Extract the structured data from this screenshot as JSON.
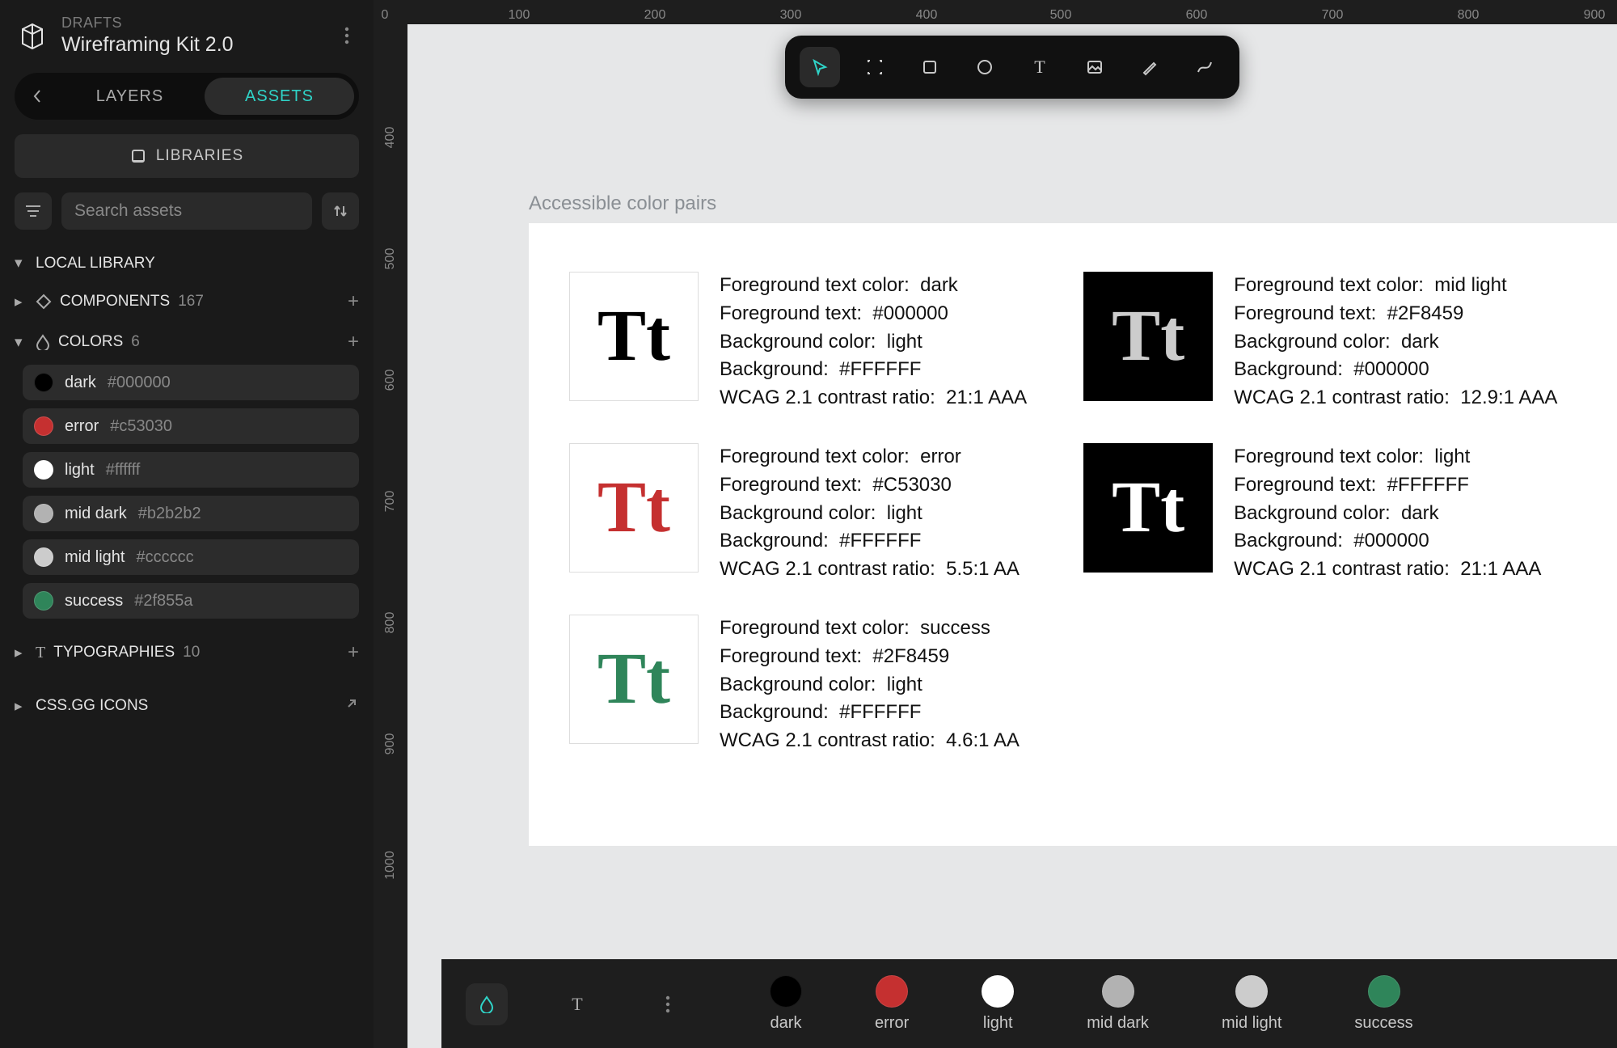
{
  "header": {
    "drafts_label": "DRAFTS",
    "file_title": "Wireframing Kit 2.0"
  },
  "tabs": {
    "back_icon": "‹",
    "layers": "LAYERS",
    "assets": "ASSETS",
    "active": "assets"
  },
  "libraries_button": "LIBRARIES",
  "search": {
    "placeholder": "Search assets"
  },
  "sections": {
    "local_library": "LOCAL LIBRARY",
    "components": {
      "label": "COMPONENTS",
      "count": "167"
    },
    "colors": {
      "label": "COLORS",
      "count": "6"
    },
    "typographies": {
      "label": "TYPOGRAPHIES",
      "count": "10"
    },
    "css_icons": {
      "label": "CSS.GG ICONS"
    }
  },
  "colors": [
    {
      "name": "dark",
      "hex": "#000000",
      "swatch": "#000000"
    },
    {
      "name": "error",
      "hex": "#c53030",
      "swatch": "#c53030"
    },
    {
      "name": "light",
      "hex": "#ffffff",
      "swatch": "#ffffff"
    },
    {
      "name": "mid dark",
      "hex": "#b2b2b2",
      "swatch": "#b2b2b2"
    },
    {
      "name": "mid light",
      "hex": "#cccccc",
      "swatch": "#cccccc"
    },
    {
      "name": "success",
      "hex": "#2f855a",
      "swatch": "#2f855a"
    }
  ],
  "ruler_h": [
    "0",
    "100",
    "200",
    "300",
    "400",
    "500",
    "600",
    "700",
    "800",
    "900"
  ],
  "ruler_v": [
    "400",
    "500",
    "600",
    "700",
    "800",
    "900",
    "1000"
  ],
  "artboard_label": "Accessible color pairs",
  "pairs_left": [
    {
      "fg_name": "dark",
      "fg_hex": "#000000",
      "bg_name": "light",
      "bg_hex": "#FFFFFF",
      "ratio": "21:1 AAA",
      "tt_fg": "#000000",
      "tt_bg": "#ffffff"
    },
    {
      "fg_name": "error",
      "fg_hex": "#C53030",
      "bg_name": "light",
      "bg_hex": "#FFFFFF",
      "ratio": "5.5:1 AA",
      "tt_fg": "#c53030",
      "tt_bg": "#ffffff"
    },
    {
      "fg_name": "success",
      "fg_hex": "#2F8459",
      "bg_name": "light",
      "bg_hex": "#FFFFFF",
      "ratio": "4.6:1 AA",
      "tt_fg": "#2f855a",
      "tt_bg": "#ffffff"
    }
  ],
  "pairs_right": [
    {
      "fg_name": "mid light",
      "fg_hex": "#2F8459",
      "bg_name": "dark",
      "bg_hex": "#000000",
      "ratio": "12.9:1 AAA",
      "tt_fg": "#cccccc",
      "tt_bg": "#000000"
    },
    {
      "fg_name": "light",
      "fg_hex": "#FFFFFF",
      "bg_name": "dark",
      "bg_hex": "#000000",
      "ratio": "21:1 AAA",
      "tt_fg": "#ffffff",
      "tt_bg": "#000000"
    }
  ],
  "meta_labels": {
    "fg_color": "Foreground text color:",
    "fg_text": "Foreground text:",
    "bg_color": "Background color:",
    "bg": "Background:",
    "wcag": "WCAG 2.1 contrast ratio:"
  },
  "palette_bar": [
    {
      "name": "dark",
      "color": "#000000"
    },
    {
      "name": "error",
      "color": "#c53030"
    },
    {
      "name": "light",
      "color": "#ffffff"
    },
    {
      "name": "mid dark",
      "color": "#b2b2b2"
    },
    {
      "name": "mid light",
      "color": "#cccccc"
    },
    {
      "name": "success",
      "color": "#2f855a"
    }
  ]
}
